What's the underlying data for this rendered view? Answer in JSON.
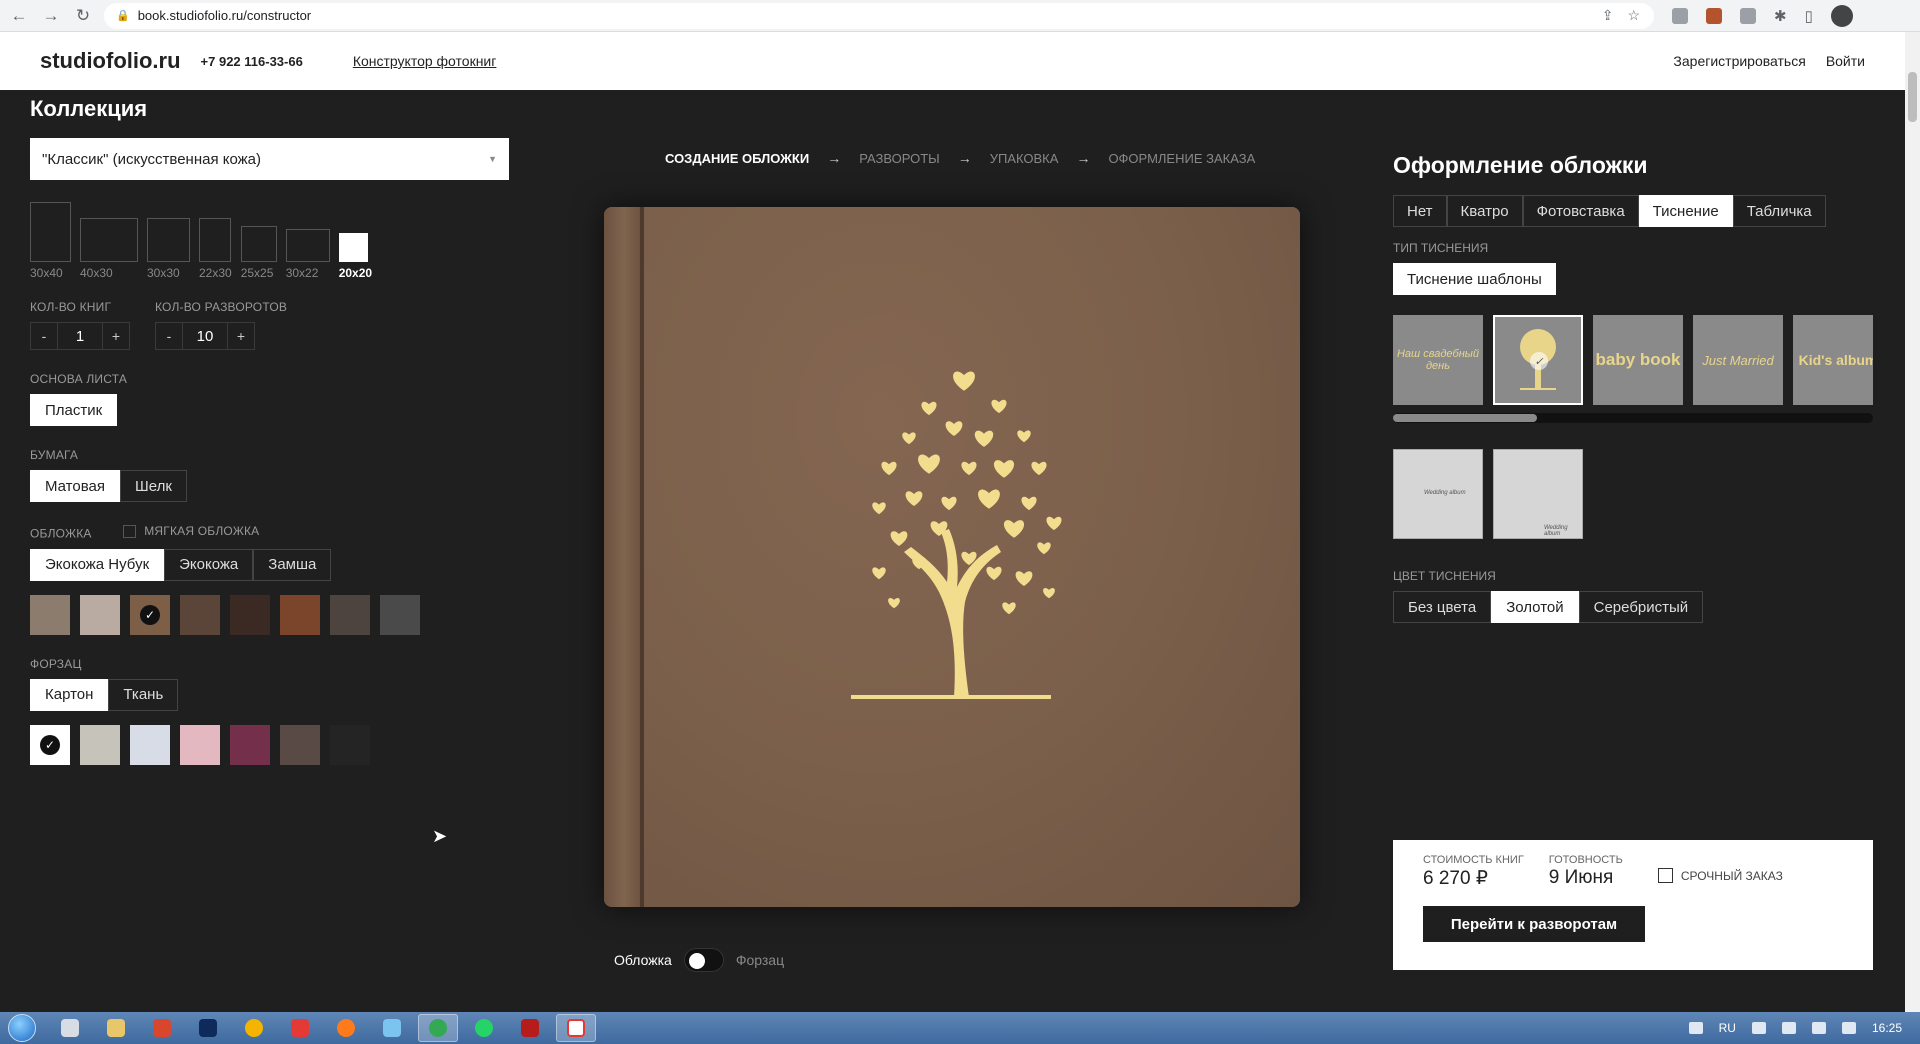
{
  "browser": {
    "url": "book.studiofolio.ru/constructor"
  },
  "site": {
    "logo": "studiofolio.ru",
    "phone": "+7 922 116-33-66",
    "nav_link": "Конструктор фотокниг",
    "register": "Зарегистрироваться",
    "login": "Войти"
  },
  "left": {
    "collection_title": "Коллекция",
    "collection_value": "\"Классик\" (искусственная кожа)",
    "sizes": [
      "30x40",
      "40x30",
      "30x30",
      "22x30",
      "25x25",
      "30x22",
      "20x20"
    ],
    "selected_size": "20x20",
    "books_label": "КОЛ-ВО КНИГ",
    "books_value": "1",
    "spreads_label": "КОЛ-ВО РАЗВОРОТОВ",
    "spreads_value": "10",
    "minus": "-",
    "plus": "+",
    "base_label": "ОСНОВА ЛИСТА",
    "base_option": "Пластик",
    "paper_label": "БУМАГА",
    "paper_options": [
      "Матовая",
      "Шелк"
    ],
    "cover_label": "ОБЛОЖКА",
    "soft_cover_label": "МЯГКАЯ ОБЛОЖКА",
    "cover_options": [
      "Экокожа Нубук",
      "Экокожа",
      "Замша"
    ],
    "cover_colors": [
      "#8c7c6e",
      "#b9aaa2",
      "#7d5f48",
      "#5a4538",
      "#3a2a23",
      "#7a452a",
      "#4d4440",
      "#4a4a4b"
    ],
    "endpaper_label": "ФОРЗАЦ",
    "endpaper_options": [
      "Картон",
      "Ткань"
    ],
    "endpaper_colors": [
      "#ffffff",
      "#c6c3bb",
      "#d8dce6",
      "#e4b8c0",
      "#74304a",
      "#5a4a45",
      "#242424"
    ]
  },
  "steps": {
    "s1": "СОЗДАНИЕ ОБЛОЖКИ",
    "s2": "РАЗВОРОТЫ",
    "s3": "УПАКОВКА",
    "s4": "ОФОРМЛЕНИЕ ЗАКАЗА",
    "arrow": "→"
  },
  "preview": {
    "cover_label": "Обложка",
    "endpaper_label": "Форзац"
  },
  "right": {
    "title": "Оформление обложки",
    "tabs": [
      "Нет",
      "Кватро",
      "Фотовставка",
      "Тиснение",
      "Табличка"
    ],
    "selected_tab": "Тиснение",
    "emboss_type_label": "ТИП ТИСНЕНИЯ",
    "emboss_type_value": "Тиснение шаблоны",
    "templates": [
      "Наш свадебный день",
      "",
      "baby book",
      "Just Married",
      "Kid's album"
    ],
    "small_templates": [
      "Wedding album",
      "Wedding album"
    ],
    "color_label": "ЦВЕТ ТИСНЕНИЯ",
    "color_options": [
      "Без цвета",
      "Золотой",
      "Серебристый"
    ],
    "selected_color": "Золотой"
  },
  "price": {
    "cost_label": "СТОИМОСТЬ КНИГ",
    "cost_value": "6 270 ₽",
    "ready_label": "ГОТОВНОСТЬ",
    "ready_value": "9 Июня",
    "urgent_label": "СРОЧНЫЙ ЗАКАЗ",
    "next_button": "Перейти к разворотам"
  },
  "taskbar": {
    "lang": "RU",
    "time": "16:25"
  },
  "colors": {
    "emboss_gold": "#f2dc8e",
    "cover_brown": "#7b604b"
  }
}
